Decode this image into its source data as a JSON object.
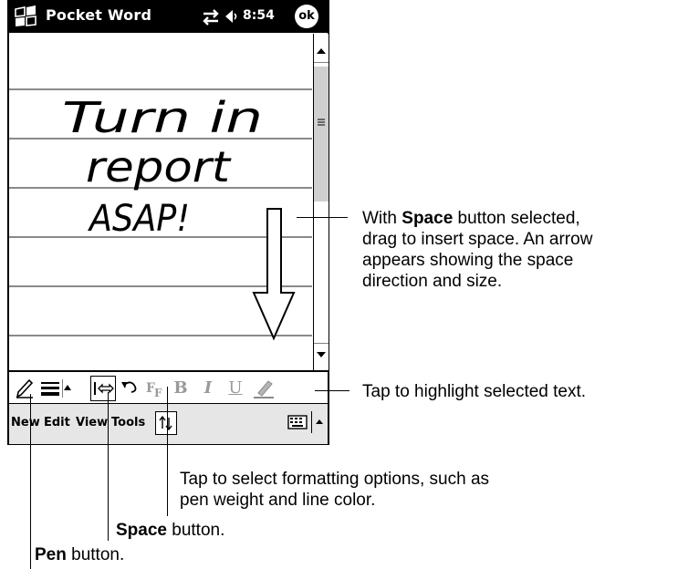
{
  "titlebar": {
    "app_title": "Pocket Word",
    "clock": "8:54",
    "ok_label": "ok",
    "icons": [
      "windows-flag-icon",
      "connectivity-icon",
      "volume-icon"
    ]
  },
  "document": {
    "handwriting": [
      "Turn in",
      "report",
      "ASAP!"
    ]
  },
  "toolbar": {
    "bold_label": "B",
    "italic_label": "I",
    "underline_label": "U",
    "icons": [
      "pen-icon",
      "line-weight-icon",
      "dropdown-arrow-icon",
      "space-icon",
      "undo-icon",
      "format-icon",
      "highlight-icon"
    ]
  },
  "menubar": {
    "new_label": "New",
    "edit_label": "Edit",
    "view_label": "View",
    "tools_label": "Tools",
    "icons": [
      "sort-icon",
      "keyboard-icon",
      "input-arrow-icon"
    ]
  },
  "callouts": {
    "space_prefix": "With ",
    "space_bold": "Space",
    "space_rest_1": " button selected,",
    "space_line2": "drag to insert space. An arrow",
    "space_line3": "appears showing the space",
    "space_line4": "direction and size.",
    "highlight": "Tap to highlight selected text.",
    "format_line1": "Tap to select formatting options, such as",
    "format_line2": "pen weight and line color.",
    "space_button_bold": "Space",
    "space_button_rest": " button.",
    "pen_button_bold": "Pen",
    "pen_button_rest": " button."
  }
}
